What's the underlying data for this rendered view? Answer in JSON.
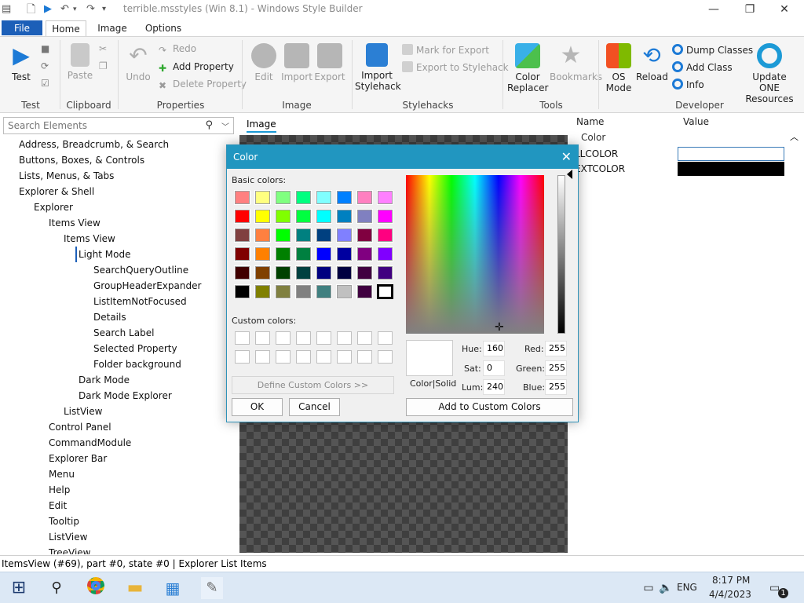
{
  "window": {
    "title": "terrible.msstyles (Win 8.1) - Windows Style Builder"
  },
  "ribbon": {
    "tabs": [
      "File",
      "Home",
      "Image",
      "Options"
    ],
    "test": {
      "label": "Test",
      "group": "Test"
    },
    "clipboard": {
      "paste": "Paste",
      "group": "Clipboard"
    },
    "properties": {
      "undo": "Undo",
      "redo": "Redo",
      "add_property": "Add Property",
      "delete_property": "Delete Property",
      "group": "Properties"
    },
    "image": {
      "edit": "Edit",
      "import": "Import",
      "export": "Export",
      "group": "Image"
    },
    "stylehacks": {
      "import_stylehack": "Import Stylehack",
      "mark_for_export": "Mark for Export",
      "export_to_stylehack": "Export to Stylehack",
      "group": "Stylehacks"
    },
    "tools": {
      "color_replacer": "Color Replacer",
      "bookmarks": "Bookmarks",
      "group": "Tools"
    },
    "developer": {
      "os_mode": "OS Mode",
      "reload": "Reload",
      "dump_classes": "Dump Classes",
      "add_class": "Add Class",
      "info": "Info",
      "update_one": "Update ONE Resources",
      "group": "Developer"
    }
  },
  "search": {
    "placeholder": "Search Elements"
  },
  "tree": [
    {
      "label": "Address, Breadcrumb, & Search",
      "depth": 0
    },
    {
      "label": "Buttons, Boxes, & Controls",
      "depth": 0
    },
    {
      "label": "Lists, Menus, & Tabs",
      "depth": 0
    },
    {
      "label": "Explorer & Shell",
      "depth": 0
    },
    {
      "label": "Explorer",
      "depth": 1
    },
    {
      "label": "Items View",
      "depth": 2
    },
    {
      "label": "Items View",
      "depth": 3
    },
    {
      "label": "Light Mode",
      "depth": 4
    },
    {
      "label": "SearchQueryOutline",
      "depth": 5
    },
    {
      "label": "GroupHeaderExpander",
      "depth": 5
    },
    {
      "label": "ListItemNotFocused",
      "depth": 5
    },
    {
      "label": "Details",
      "depth": 5
    },
    {
      "label": "Search Label",
      "depth": 5
    },
    {
      "label": "Selected Property",
      "depth": 5
    },
    {
      "label": "Folder background",
      "depth": 5
    },
    {
      "label": "Dark Mode",
      "depth": 4
    },
    {
      "label": "Dark Mode Explorer",
      "depth": 4
    },
    {
      "label": "ListView",
      "depth": 3
    },
    {
      "label": "Control Panel",
      "depth": 2
    },
    {
      "label": "CommandModule",
      "depth": 2
    },
    {
      "label": "Explorer Bar",
      "depth": 2
    },
    {
      "label": "Menu",
      "depth": 2
    },
    {
      "label": "Help",
      "depth": 2
    },
    {
      "label": "Edit",
      "depth": 2
    },
    {
      "label": "Tooltip",
      "depth": 2
    },
    {
      "label": "ListView",
      "depth": 2
    },
    {
      "label": "TreeView",
      "depth": 2
    }
  ],
  "image_panel": {
    "tab": "Image"
  },
  "properties_panel": {
    "col_name": "Name",
    "col_value": "Value",
    "section": "Color",
    "rows": [
      {
        "name": "LLCOLOR",
        "value_color": "#ffffff"
      },
      {
        "name": "EXTCOLOR",
        "value_color": "#000000"
      }
    ]
  },
  "status": {
    "text": "ItemsView (#69), part #0, state #0  |  Explorer List Items"
  },
  "taskbar": {
    "language": "ENG",
    "time": "8:17 PM",
    "date": "4/4/2023",
    "notification_count": "1"
  },
  "color_dialog": {
    "title": "Color",
    "basic_colors_label": "Basic colors:",
    "custom_colors_label": "Custom colors:",
    "define_custom": "Define Custom Colors >>",
    "ok": "OK",
    "cancel": "Cancel",
    "add_to_custom": "Add to Custom Colors",
    "color_solid_label": "Color|Solid",
    "hue_label": "Hue:",
    "hue": "160",
    "sat_label": "Sat:",
    "sat": "0",
    "lum_label": "Lum:",
    "lum": "240",
    "red_label": "Red:",
    "red": "255",
    "green_label": "Green:",
    "green": "255",
    "blue_label": "Blue:",
    "blue": "255",
    "basic_colors": [
      "#ff8080",
      "#ffff80",
      "#80ff80",
      "#00ff80",
      "#80ffff",
      "#0080ff",
      "#ff80c0",
      "#ff80ff",
      "#ff0000",
      "#ffff00",
      "#80ff00",
      "#00ff40",
      "#00ffff",
      "#0080c0",
      "#8080c0",
      "#ff00ff",
      "#804040",
      "#ff8040",
      "#00ff00",
      "#008080",
      "#004080",
      "#8080ff",
      "#800040",
      "#ff0080",
      "#800000",
      "#ff8000",
      "#008000",
      "#008040",
      "#0000ff",
      "#0000a0",
      "#800080",
      "#8000ff",
      "#400000",
      "#804000",
      "#004000",
      "#004040",
      "#000080",
      "#000040",
      "#400040",
      "#400080",
      "#000000",
      "#808000",
      "#808040",
      "#808080",
      "#408080",
      "#c0c0c0",
      "#400040",
      "#ffffff"
    ],
    "selected_index": 47,
    "preview_color": "#ffffff"
  }
}
